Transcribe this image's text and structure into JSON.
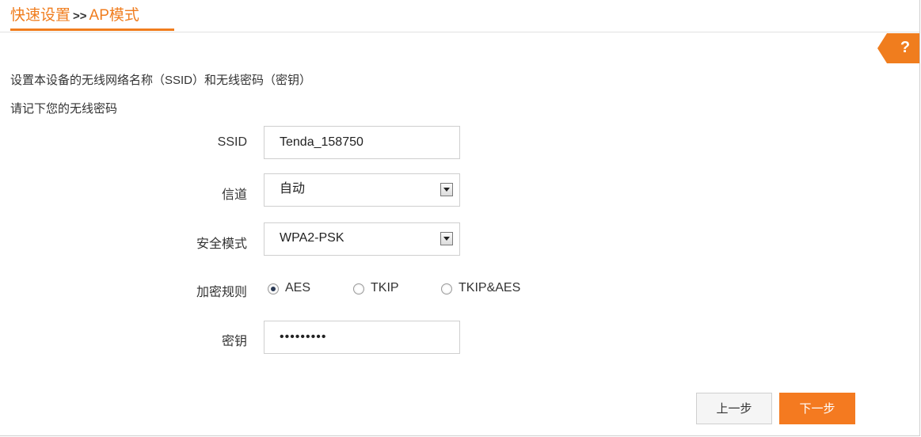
{
  "breadcrumb": {
    "quick_setup": "快速设置",
    "separator": ">>",
    "ap_mode": "AP模式"
  },
  "help": {
    "label": "?",
    "icon": "help-icon",
    "color": "#f07d1e"
  },
  "intro": {
    "line1": "设置本设备的无线网络名称（SSID）和无线密码（密钥）",
    "line2": "请记下您的无线密码"
  },
  "form": {
    "ssid_label": "SSID",
    "ssid_value": "Tenda_158750",
    "channel_label": "信道",
    "channel_value": "自动",
    "security_label": "安全模式",
    "security_value": "WPA2-PSK",
    "encryption_label": "加密规则",
    "encryption_options": [
      {
        "label": "AES",
        "checked": true
      },
      {
        "label": "TKIP",
        "checked": false
      },
      {
        "label": "TKIP&AES",
        "checked": false
      }
    ],
    "key_label": "密钥",
    "key_value": "•••••••••"
  },
  "buttons": {
    "prev": "上一步",
    "next": "下一步"
  },
  "colors": {
    "accent": "#f07d1e",
    "button_primary": "#f47a20"
  }
}
